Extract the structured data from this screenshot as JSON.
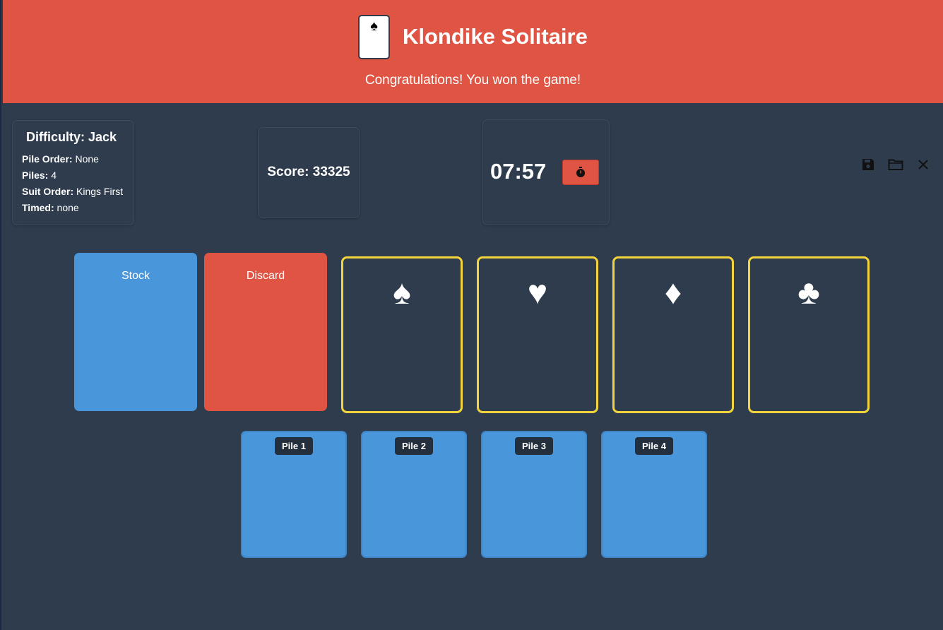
{
  "header": {
    "logo_suit": "♠",
    "title": "Klondike Solitaire",
    "message": "Congratulations! You won the game!"
  },
  "difficulty": {
    "heading": "Difficulty: Jack",
    "pile_order_label": "Pile Order:",
    "pile_order_value": "None",
    "piles_label": "Piles:",
    "piles_value": "4",
    "suit_order_label": "Suit Order:",
    "suit_order_value": "Kings First",
    "timed_label": "Timed:",
    "timed_value": "none"
  },
  "score": {
    "text": "Score: 33325"
  },
  "timer": {
    "time": "07:57",
    "button_icon": "stopwatch-icon"
  },
  "toolbar": {
    "icons": [
      "save-icon",
      "folder-icon",
      "close-icon"
    ]
  },
  "board": {
    "stock_label": "Stock",
    "discard_label": "Discard",
    "foundations": [
      {
        "suit": "♠",
        "name": "spade"
      },
      {
        "suit": "♥",
        "name": "heart"
      },
      {
        "suit": "♦",
        "name": "diamond"
      },
      {
        "suit": "♣",
        "name": "club"
      }
    ],
    "piles": [
      {
        "label": "Pile 1"
      },
      {
        "label": "Pile 2"
      },
      {
        "label": "Pile 3"
      },
      {
        "label": "Pile 4"
      }
    ]
  },
  "colors": {
    "header_bg": "#e05444",
    "page_bg": "#2e3c4d",
    "stock_blue": "#4a96da",
    "foundation_border": "#f3d53b"
  }
}
